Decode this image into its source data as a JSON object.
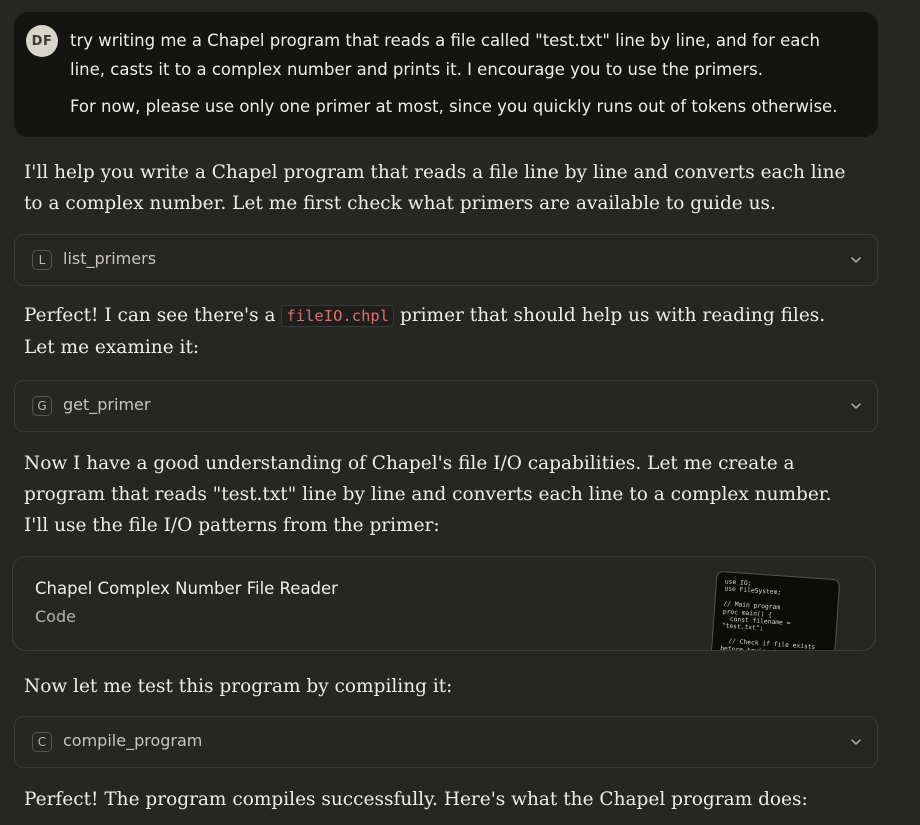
{
  "user": {
    "avatar_initials": "DF",
    "message_line1": "try writing me a Chapel program that reads a file called \"test.txt\" line by line, and for each line, casts it to a complex number and prints it. I encourage you to use the primers.",
    "message_line2": "For now, please use only one primer at most, since you quickly runs out of tokens otherwise."
  },
  "assistant": {
    "msg1": "I'll help you write a Chapel program that reads a file line by line and converts each line to a complex number. Let me first check what primers are available to guide us.",
    "tool1": {
      "letter": "L",
      "name": "list_primers"
    },
    "msg2_before": "Perfect! I can see there's a ",
    "msg2_code": "fileIO.chpl",
    "msg2_after": " primer that should help us with reading files. Let me examine it:",
    "tool2": {
      "letter": "G",
      "name": "get_primer"
    },
    "msg3": "Now I have a good understanding of Chapel's file I/O capabilities. Let me create a program that reads \"test.txt\" line by line and converts each line to a complex number. I'll use the file I/O patterns from the primer:",
    "artifact": {
      "title": "Chapel Complex Number File Reader",
      "type": "Code",
      "preview": "use IO;\nuse FileSystem;\n\n// Main program\nproc main() {\n  const filename =\n\"test.txt\";\n\n  // Check if file exists\nbefore trying to"
    },
    "msg4": "Now let me test this program by compiling it:",
    "tool3": {
      "letter": "C",
      "name": "compile_program"
    },
    "msg5": "Perfect! The program compiles successfully. Here's what the Chapel program does:"
  },
  "icons": {
    "tool_expand": "chevron-down-icon"
  }
}
